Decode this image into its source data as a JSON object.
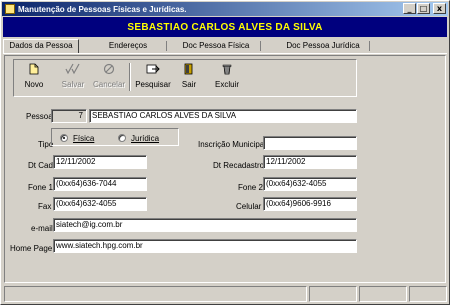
{
  "window": {
    "title": "Manutenção de Pessoas Físicas e Jurídicas.",
    "minimize_glyph": "_",
    "maximize_glyph": "□",
    "close_glyph": "x"
  },
  "banner": {
    "name": "SEBASTIAO CARLOS ALVES DA SILVA"
  },
  "tabs": [
    {
      "label": "Dados da Pessoa",
      "active": true
    },
    {
      "label": "Endereços"
    },
    {
      "label": "Doc Pessoa Física"
    },
    {
      "label": "Doc Pessoa Jurídica"
    }
  ],
  "toolbar": {
    "items": [
      {
        "label": "Novo",
        "icon": "new-document-icon",
        "enabled": true
      },
      {
        "label": "Salvar",
        "icon": "check-icon",
        "enabled": false
      },
      {
        "label": "Cancelar",
        "icon": "cancel-icon",
        "enabled": false
      },
      {
        "label": "Pesquisar",
        "icon": "search-arrow-icon",
        "enabled": true
      },
      {
        "label": "Sair",
        "icon": "exit-door-icon",
        "enabled": true
      },
      {
        "label": "Excluir",
        "icon": "delete-icon",
        "enabled": true
      }
    ]
  },
  "form": {
    "pessoa_label": "Pessoa",
    "pessoa_id": "7",
    "pessoa_nome": "SEBASTIAO CARLOS ALVES DA SILVA",
    "tipo_label": "Tipo",
    "tipo_fisica": "Física",
    "tipo_juridica": "Jurídica",
    "tipo_selected": "Física",
    "inscricao_label": "Inscrição Municipal",
    "inscricao_value": "",
    "dtcad_label": "Dt Cad",
    "dtcad_value": "12/11/2002",
    "dtrecad_label": "Dt Recadastro",
    "dtrecad_value": "12/11/2002",
    "fone1_label": "Fone 1",
    "fone1_value": "(0xx64)636-7044",
    "fone2_label": "Fone 2",
    "fone2_value": "(0xx64)632-4055",
    "fax_label": "Fax",
    "fax_value": "(0xx64)632-4055",
    "celular_label": "Celular",
    "celular_value": "(0xx64)9606-9916",
    "email_label": "e-mail",
    "email_value": "siatech@ig.com.br",
    "homepage_label": "Home Page",
    "homepage_value": "www.siatech.hpg.com.br"
  },
  "colors": {
    "banner_bg": "#00007e",
    "banner_text": "#ffff00",
    "title_gradient_start": "#0a246a",
    "title_gradient_end": "#a6caf0"
  }
}
